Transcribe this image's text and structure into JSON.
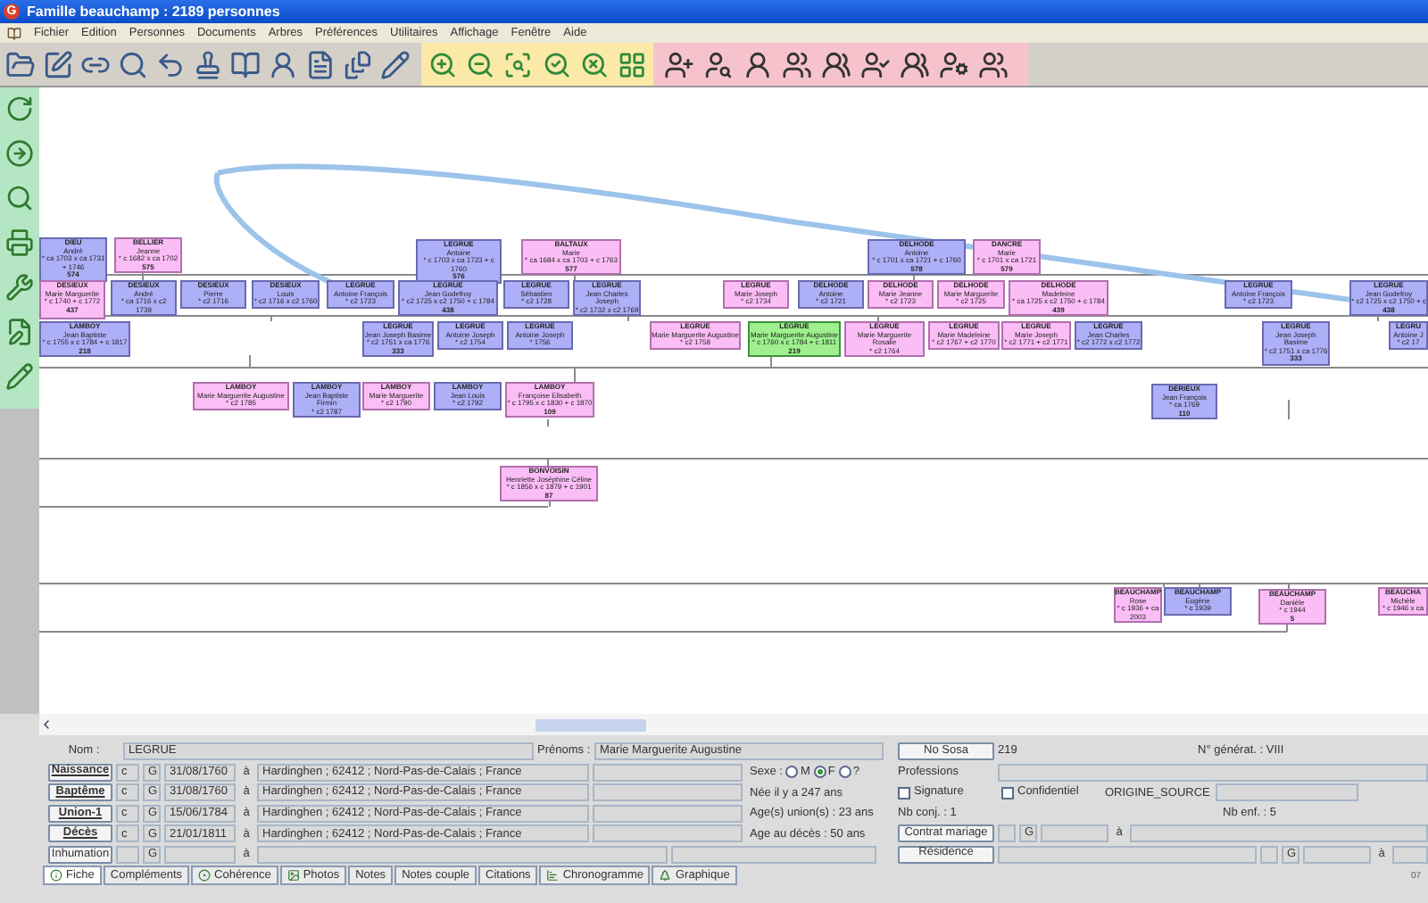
{
  "window": {
    "logo_letter": "G",
    "title": "Famille beauchamp : 2189 personnes"
  },
  "menu": [
    "Fichier",
    "Edition",
    "Personnes",
    "Documents",
    "Arbres",
    "Préférences",
    "Utilitaires",
    "Affichage",
    "Fenêtre",
    "Aide"
  ],
  "tree": {
    "nodes": [
      {
        "surname": "DIEU",
        "given": "André",
        "dates": "* ca 1703 x ca 1731 + 1746",
        "number": "574",
        "kind": "male",
        "selected": false
      },
      {
        "surname": "BELLIER",
        "given": "Jeanne",
        "dates": "* c 1682 x ca 1702",
        "number": "575",
        "kind": "female",
        "selected": false
      },
      {
        "surname": "LEGRUE",
        "given": "Antoine",
        "dates": "* c 1703 x ca 1723 + c 1760",
        "number": "576",
        "kind": "male",
        "selected": false
      },
      {
        "surname": "BALTAUX",
        "given": "Marie",
        "dates": "* ca 1684 x ca 1703 + c 1763",
        "number": "577",
        "kind": "female",
        "selected": false
      },
      {
        "surname": "DELHODE",
        "given": "Antoine",
        "dates": "* c 1701 x ca 1721 + c 1760",
        "number": "578",
        "kind": "male",
        "selected": false
      },
      {
        "surname": "DANCRE",
        "given": "Marie",
        "dates": "* c 1701 x ca 1721",
        "number": "579",
        "kind": "female",
        "selected": false
      },
      {
        "surname": "DESIEUX",
        "given": "Marie Marguerite",
        "dates": "* c 1740 + c 1772",
        "number": "437",
        "kind": "female",
        "selected": false
      },
      {
        "surname": "DESIEUX",
        "given": "André",
        "dates": "* ca 1716 x c2 1739",
        "kind": "male",
        "selected": false
      },
      {
        "surname": "DESIEUX",
        "given": "Pierre",
        "dates": "* c2 1716",
        "kind": "male",
        "selected": false
      },
      {
        "surname": "DESIEUX",
        "given": "Louis",
        "dates": "* c2 1716 x c2 1760",
        "kind": "male",
        "selected": false
      },
      {
        "surname": "LEGRUE",
        "given": "Antoine François",
        "dates": "* c2 1723",
        "kind": "male",
        "selected": false
      },
      {
        "surname": "LEGRUE",
        "given": "Jean Godefroy",
        "dates": "* c2 1725 x c2 1750 + c 1784",
        "number": "438",
        "kind": "male",
        "selected": false
      },
      {
        "surname": "LEGRUE",
        "given": "Sébastien",
        "dates": "* c2 1728",
        "kind": "male",
        "selected": false
      },
      {
        "surname": "LEGRUE",
        "given": "Jean Charles Joseph",
        "dates": "* c2 1732 x c2 1769",
        "kind": "male",
        "selected": false
      },
      {
        "surname": "LEGRUE",
        "given": "Marie Joseph",
        "dates": "* c2 1734",
        "kind": "female",
        "selected": false
      },
      {
        "surname": "DELHODE",
        "given": "Antoine",
        "dates": "* c2 1721",
        "kind": "male",
        "selected": false
      },
      {
        "surname": "DELHODE",
        "given": "Marie Jeanne",
        "dates": "* c2 1723",
        "kind": "female",
        "selected": false
      },
      {
        "surname": "DELHODE",
        "given": "Marie Marguerite",
        "dates": "* c2 1725",
        "kind": "female",
        "selected": false
      },
      {
        "surname": "DELHODE",
        "given": "Madeleine",
        "dates": "* ca 1725 x c2 1750 + c 1784",
        "number": "439",
        "kind": "female",
        "selected": false
      },
      {
        "surname": "LEGRUE",
        "given": "Antoine François",
        "dates": "* c2 1723",
        "kind": "male",
        "selected": false
      },
      {
        "surname": "LEGRUE",
        "given": "Jean Godefroy",
        "dates": "* c2 1725 x c2 1750 + c",
        "number": "438",
        "kind": "male",
        "selected": false
      },
      {
        "surname": "LAMBOY",
        "given": "Jean Baptiste",
        "dates": "* c 1755 x c 1784 + c 1817",
        "number": "218",
        "kind": "male",
        "selected": false
      },
      {
        "surname": "LEGRUE",
        "given": "Jean Joseph Basime",
        "dates": "* c2 1751 x ca 1776",
        "number": "333",
        "kind": "male",
        "selected": false
      },
      {
        "surname": "LEGRUE",
        "given": "Antoine Joseph",
        "dates": "* c2 1754",
        "kind": "male",
        "selected": false
      },
      {
        "surname": "LEGRUE",
        "given": "Antoine Joseph",
        "dates": "* 1756",
        "kind": "male",
        "selected": false
      },
      {
        "surname": "LEGRUE",
        "given": "Marie Marguerite Augustine",
        "dates": "* c2 1758",
        "kind": "female",
        "selected": false
      },
      {
        "surname": "LEGRUE",
        "given": "Marie Marguerite Augustine",
        "dates": "* c 1760 x c 1784 + c 1811",
        "number": "219",
        "kind": "female",
        "selected": true
      },
      {
        "surname": "LEGRUE",
        "given": "Marie Marguerite Rosalie",
        "dates": "* c2 1764",
        "kind": "female",
        "selected": false
      },
      {
        "surname": "LEGRUE",
        "given": "Marie Madeleine",
        "dates": "* c2 1767 + c2 1770",
        "kind": "female",
        "selected": false
      },
      {
        "surname": "LEGRUE",
        "given": "Marie Joseph",
        "dates": "* c2 1771 + c2 1771",
        "kind": "female",
        "selected": false
      },
      {
        "surname": "LEGRUE",
        "given": "Jean Charles",
        "dates": "* c2 1772 x c2 1772",
        "kind": "male",
        "selected": false
      },
      {
        "surname": "LEGRUE",
        "given": "Jean Joseph Basime",
        "dates": "* c2 1751 x ca 1776",
        "number": "333",
        "kind": "male",
        "selected": false
      },
      {
        "surname": "LEGRU",
        "given": "Antoine J",
        "dates": "* c2 17",
        "kind": "male",
        "selected": false
      },
      {
        "surname": "LAMBOY",
        "given": "Marie Marguerite Augustine",
        "dates": "* c2 1785",
        "kind": "female",
        "selected": false
      },
      {
        "surname": "LAMBOY",
        "given": "Jean Baptiste Firmin",
        "dates": "* c2 1787",
        "kind": "male",
        "selected": false
      },
      {
        "surname": "LAMBOY",
        "given": "Marie Marguerite",
        "dates": "* c2 1790",
        "kind": "female",
        "selected": false
      },
      {
        "surname": "LAMBOY",
        "given": "Jean Louis",
        "dates": "* c2 1792",
        "kind": "male",
        "selected": false
      },
      {
        "surname": "LAMBOY",
        "given": "Françoise Elisabeth",
        "dates": "* c 1795 x c 1830 + c 1870",
        "number": "109",
        "kind": "female",
        "selected": false
      },
      {
        "surname": "DERIEUX",
        "given": "Jean François",
        "dates": "* ca 1769",
        "number": "110",
        "kind": "male",
        "selected": false
      },
      {
        "surname": "BONVOISIN",
        "given": "Henriette Joséphine Céline",
        "dates": "* c 1856 x c 1879 + c 1901",
        "number": "87",
        "kind": "female",
        "selected": false
      },
      {
        "surname": "BEAUCHAMP",
        "given": "Rose",
        "dates": "* c 1936 + ca 2003",
        "kind": "female",
        "selected": false
      },
      {
        "surname": "BEAUCHAMP",
        "given": "Eugène",
        "dates": "* c 1939",
        "kind": "male",
        "selected": false
      },
      {
        "surname": "BEAUCHAMP",
        "given": "Danièle",
        "dates": "* c 1944",
        "number": "5",
        "kind": "female",
        "selected": false
      },
      {
        "surname": "BEAUCHA",
        "given": "Michèle",
        "dates": "* c 1946 x ca",
        "kind": "female",
        "selected": false
      }
    ]
  },
  "form": {
    "nom_label": "Nom :",
    "nom": "LEGRUE",
    "prenoms_label": "Prénoms :",
    "prenoms": "Marie Marguerite Augustine",
    "sosa_button": "No Sosa",
    "sosa": "219",
    "generation": "N° générat. : VIII",
    "events": [
      {
        "label": "Naissance",
        "kind": "linked",
        "code": "c",
        "g": "G",
        "date": "31/08/1760",
        "a": "à",
        "place": "Hardinghen ; 62412 ; Nord-Pas-de-Calais ; France"
      },
      {
        "label": "Baptême",
        "kind": "linked",
        "code": "c",
        "g": "G",
        "date": "31/08/1760",
        "a": "à",
        "place": "Hardinghen ; 62412 ; Nord-Pas-de-Calais ; France"
      },
      {
        "label": "Union-1",
        "kind": "linked",
        "code": "c",
        "g": "G",
        "date": "15/06/1784",
        "a": "à",
        "place": "Hardinghen ; 62412 ; Nord-Pas-de-Calais ; France"
      },
      {
        "label": "Décès",
        "kind": "linked",
        "code": "c",
        "g": "G",
        "date": "21/01/1811",
        "a": "à",
        "place": "Hardinghen ; 62412 ; Nord-Pas-de-Calais ; France"
      },
      {
        "label": "Inhumation",
        "kind": "plain",
        "g": "G",
        "a": "à"
      }
    ],
    "sex": {
      "label": "Sexe :",
      "options": [
        {
          "label": "M",
          "selected": false
        },
        {
          "label": "F",
          "selected": true
        },
        {
          "label": "?",
          "selected": false
        }
      ]
    },
    "ages": [
      "Née il y a 247 ans",
      "Age(s) union(s) : 23 ans",
      "Age au décès : 50 ans"
    ],
    "professions_label": "Professions",
    "checks": [
      {
        "label": "Signature",
        "checked": false
      },
      {
        "label": "Confidentiel",
        "checked": false
      }
    ],
    "origine_label": "ORIGINE_SOURCE",
    "nb_conj": "Nb conj. : 1",
    "nb_enf": "Nb enf. : 5",
    "contrat": {
      "button": "Contrat mariage",
      "g": "G",
      "a": "à"
    },
    "residence": {
      "button": "Résidence",
      "g": "G",
      "a": "à"
    }
  },
  "tabs": [
    {
      "label": "Fiche",
      "selected": true
    },
    {
      "label": "Compléments",
      "selected": false
    },
    {
      "label": "Cohérence",
      "selected": false
    },
    {
      "label": "Photos",
      "selected": false
    },
    {
      "label": "Notes",
      "selected": false
    },
    {
      "label": "Notes couple",
      "selected": false
    },
    {
      "label": "Citations",
      "selected": false
    },
    {
      "label": "Chronogramme",
      "selected": false
    },
    {
      "label": "Graphique",
      "selected": false
    }
  ],
  "corner_text": "07"
}
